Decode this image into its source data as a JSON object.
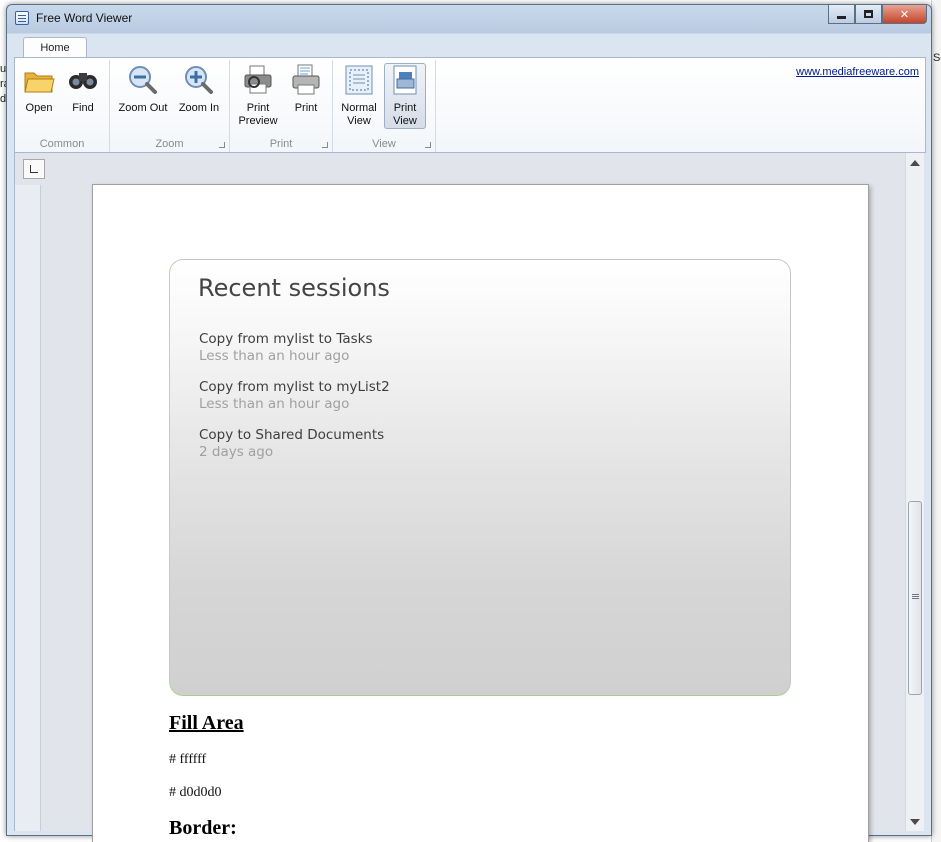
{
  "window": {
    "title": "Free Word Viewer",
    "controls": {
      "minimize": "",
      "maximize": "",
      "close": "✕"
    }
  },
  "ribbon": {
    "tabs": [
      {
        "label": "Home"
      }
    ],
    "link": "www.mediafreeware.com",
    "groups": [
      {
        "label": "Common",
        "buttons": [
          {
            "label": "Open",
            "icon": "folder-icon"
          },
          {
            "label": "Find",
            "icon": "binoculars-icon"
          }
        ]
      },
      {
        "label": "Zoom",
        "buttons": [
          {
            "label": "Zoom Out",
            "icon": "zoom-out-icon"
          },
          {
            "label": "Zoom In",
            "icon": "zoom-in-icon"
          }
        ]
      },
      {
        "label": "Print",
        "buttons": [
          {
            "label": "Print Preview",
            "icon": "print-preview-icon"
          },
          {
            "label": "Print",
            "icon": "printer-icon"
          }
        ]
      },
      {
        "label": "View",
        "buttons": [
          {
            "label": "Normal View",
            "icon": "normal-view-icon"
          },
          {
            "label": "Print View",
            "icon": "print-view-icon",
            "active": true
          }
        ]
      }
    ]
  },
  "document": {
    "panel": {
      "title": "Recent sessions",
      "sessions": [
        {
          "name": "Copy from mylist to Tasks",
          "time": "Less than an hour ago"
        },
        {
          "name": "Copy from mylist to myList2",
          "time": "Less than an hour ago"
        },
        {
          "name": "Copy to Shared Documents",
          "time": "2 days ago"
        }
      ]
    },
    "heading": "Fill Area",
    "colors": [
      "# ffffff",
      "# d0d0d0"
    ],
    "next_heading": "Border:"
  },
  "background": {
    "left_fragments": [
      "u",
      "ra",
      "d"
    ],
    "right_fragment": "Se"
  }
}
